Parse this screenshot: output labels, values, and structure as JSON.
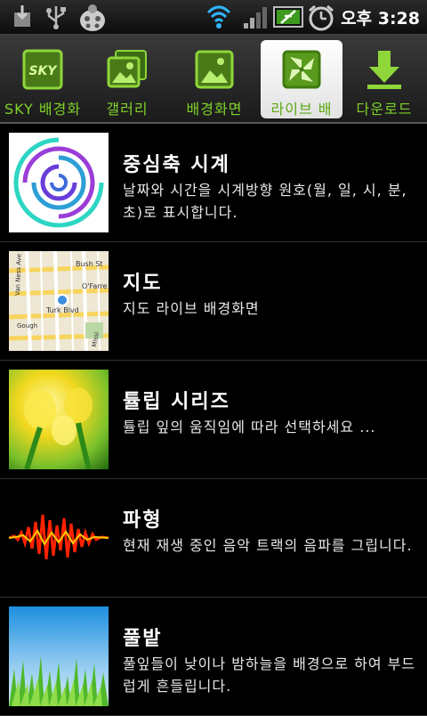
{
  "status": {
    "time": "오후 3:28",
    "icons": [
      "download-icon",
      "usb-icon",
      "ladybug-icon",
      "wifi-icon",
      "signal-icon",
      "battery-icon",
      "alarm-icon"
    ]
  },
  "tabs": [
    {
      "label": "SKY 배경화",
      "icon": "sky-icon",
      "logo_text": "SKY",
      "active": false
    },
    {
      "label": "갤러리",
      "icon": "gallery-icon",
      "active": false
    },
    {
      "label": "배경화면",
      "icon": "wallpaper-icon",
      "active": false
    },
    {
      "label": "라이브 배",
      "icon": "live-wallpaper-icon",
      "active": true
    },
    {
      "label": "다운로드",
      "icon": "download-icon",
      "active": false
    }
  ],
  "items": [
    {
      "title": "중심축 시계",
      "desc": "날짜와 시간을 시계방향 원호(월, 일, 시, 분, 초)로 표시합니다."
    },
    {
      "title": "지도",
      "desc": "지도 라이브 배경화면",
      "map_labels": [
        "Bush St",
        "Van Ness Ave",
        "O'Farre",
        "Turk Blvd",
        "Gough",
        "Missi"
      ]
    },
    {
      "title": "튤립 시리즈",
      "desc": "튤립 잎의 움직임에 따라 선택하세요 ..."
    },
    {
      "title": "파형",
      "desc": "현재 재생 중인 음악 트랙의 음파를 그립니다."
    },
    {
      "title": "풀밭",
      "desc": "풀잎들이 낮이나 밤하늘을 배경으로 하여 부드럽게 흔들립니다."
    }
  ],
  "colors": {
    "accent": "#7fd22a",
    "background": "#000000"
  }
}
